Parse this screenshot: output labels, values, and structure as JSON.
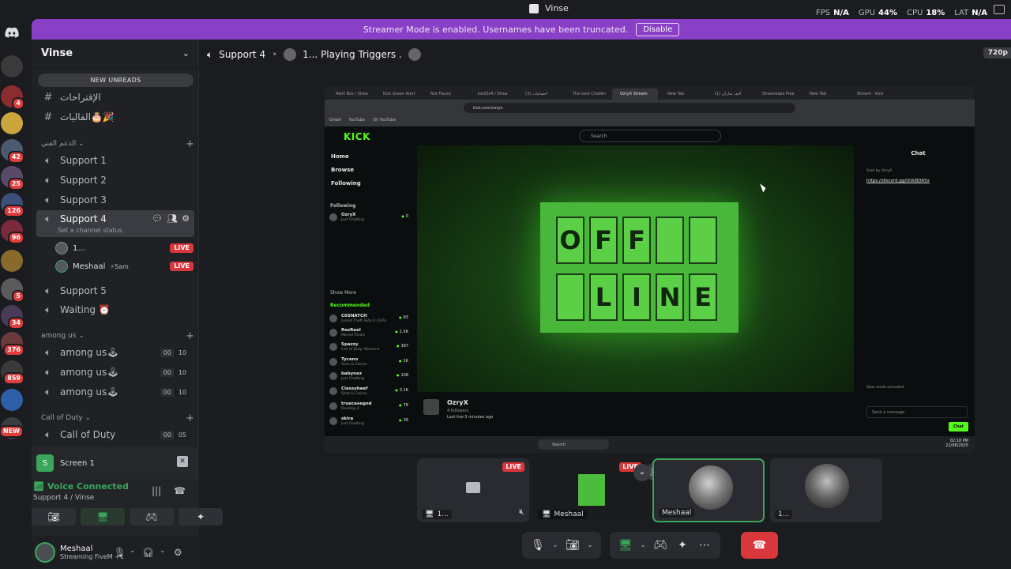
{
  "titlebar": {
    "title": "Vinse",
    "stats": [
      {
        "label": "FPS",
        "value": "N/A"
      },
      {
        "label": "GPU",
        "value": "44%"
      },
      {
        "label": "CPU",
        "value": "18%"
      },
      {
        "label": "LAT",
        "value": "N/A"
      }
    ]
  },
  "banner": {
    "text": "Streamer Mode is enabled. Usernames have been truncated.",
    "button": "Disable"
  },
  "rail": {
    "servers": [
      {
        "badge": ""
      },
      {
        "badge": "4"
      },
      {
        "badge": ""
      },
      {
        "badge": "42"
      },
      {
        "badge": "25"
      },
      {
        "badge": "126"
      },
      {
        "badge": "96"
      },
      {
        "badge": ""
      },
      {
        "badge": "5"
      },
      {
        "badge": "34"
      },
      {
        "badge": "376"
      },
      {
        "badge": "859"
      },
      {
        "badge": ""
      },
      {
        "badge": "NEW"
      }
    ]
  },
  "sidebar": {
    "server_name": "Vinse",
    "new_unreads": "NEW UNREADS",
    "text_channels": [
      {
        "name": "الإقتراحات"
      },
      {
        "name": "الفاليات🎂🎉"
      }
    ],
    "category_support": "الدعم الفني",
    "support_channels": [
      "Support 1",
      "Support 2",
      "Support 3"
    ],
    "active_channel": {
      "name": "Support 4",
      "status": "Set a channel status"
    },
    "voice_users": [
      {
        "name": "1...",
        "live": "LIVE"
      },
      {
        "name": "Meshaal",
        "activity": "Sam",
        "live": "LIVE"
      }
    ],
    "more_channels": [
      "Support 5",
      "Waiting ⏰"
    ],
    "category_among": "among us",
    "among_channels": [
      {
        "name": "among us🕹",
        "a": "00",
        "b": "10"
      },
      {
        "name": "among us🕹",
        "a": "00",
        "b": "10"
      },
      {
        "name": "among us🕹",
        "a": "00",
        "b": "10"
      }
    ],
    "category_cod": "Call of Duty",
    "cod_channels": [
      {
        "name": "Call of Duty",
        "a": "00",
        "b": "05"
      }
    ]
  },
  "screen_panel": {
    "label": "Screen 1"
  },
  "voice": {
    "status": "Voice Connected",
    "location": "Support 4 / Vinse"
  },
  "user": {
    "name": "Meshaal",
    "status": "Streaming FiveM +1"
  },
  "stage": {
    "channel": "Support 4",
    "activity": "1... Playing Triggers .",
    "quality": "720p"
  },
  "share": {
    "tabs": [
      "Alert Box / Strea",
      "Kick Green Alert",
      "Not Found",
      "kw32x4 / Strea",
      "احصائيات (3)",
      "The best Challen",
      "OzryX Stream",
      "New Tab",
      "لايف شارلي (1)",
      "Streamlabs Free",
      "New Tab",
      "Stream - Kick"
    ],
    "url": "kick.com/ozryx",
    "bookmarks": [
      "Gmail",
      "YouTube",
      "(8) YouTube"
    ],
    "logo": "KICK",
    "search": "Search",
    "nav": [
      "Home",
      "Browse",
      "Following"
    ],
    "following_label": "Following",
    "following": [
      {
        "name": "OzryX",
        "game": "Just Chatting",
        "count": "0"
      }
    ],
    "show_more": "Show More",
    "recommended_label": "Recommended",
    "recommended": [
      {
        "name": "C0SNATCH",
        "game": "Grand Theft Auto V (GTA)",
        "count": "83"
      },
      {
        "name": "RezReel",
        "game": "Marvel Rivals",
        "count": "1.5K"
      },
      {
        "name": "Spazzy",
        "game": "Call of Duty: Warzone",
        "count": "397"
      },
      {
        "name": "Tyceno",
        "game": "Slots & Casino",
        "count": "1K"
      },
      {
        "name": "babynez",
        "game": "Just Chatting",
        "count": "108"
      },
      {
        "name": "Classybeef",
        "game": "Slots & Casino",
        "count": "3.1K"
      },
      {
        "name": "truecasegod",
        "game": "Desktop 2",
        "count": "76"
      },
      {
        "name": "skira",
        "game": "Just Chatting",
        "count": "39"
      }
    ],
    "board_top": [
      "O",
      "F",
      "F",
      "",
      ""
    ],
    "board_bottom": [
      "",
      "L",
      "I",
      "N",
      "E"
    ],
    "streamer": {
      "name": "OzryX",
      "followers": "4 followers",
      "last_live": "Last live 5 minutes ago"
    },
    "chat_title": "Chat",
    "chat_sent": "Sent by OzryX",
    "chat_link": "https://discord.gg/UUkBDA5x",
    "slow_mode": "Slow mode activated",
    "chat_placeholder": "Send a message",
    "chat_button": "Chat",
    "taskbar_search": "Search",
    "clock": "02:18 PM",
    "date": "21/08/2025"
  },
  "tiles": [
    {
      "label": "1...",
      "live": "LIVE"
    },
    {
      "label": "Meshaal",
      "live": "LIVE"
    },
    {
      "label": "Meshaal",
      "live": ""
    },
    {
      "label": "1...",
      "live": ""
    }
  ]
}
